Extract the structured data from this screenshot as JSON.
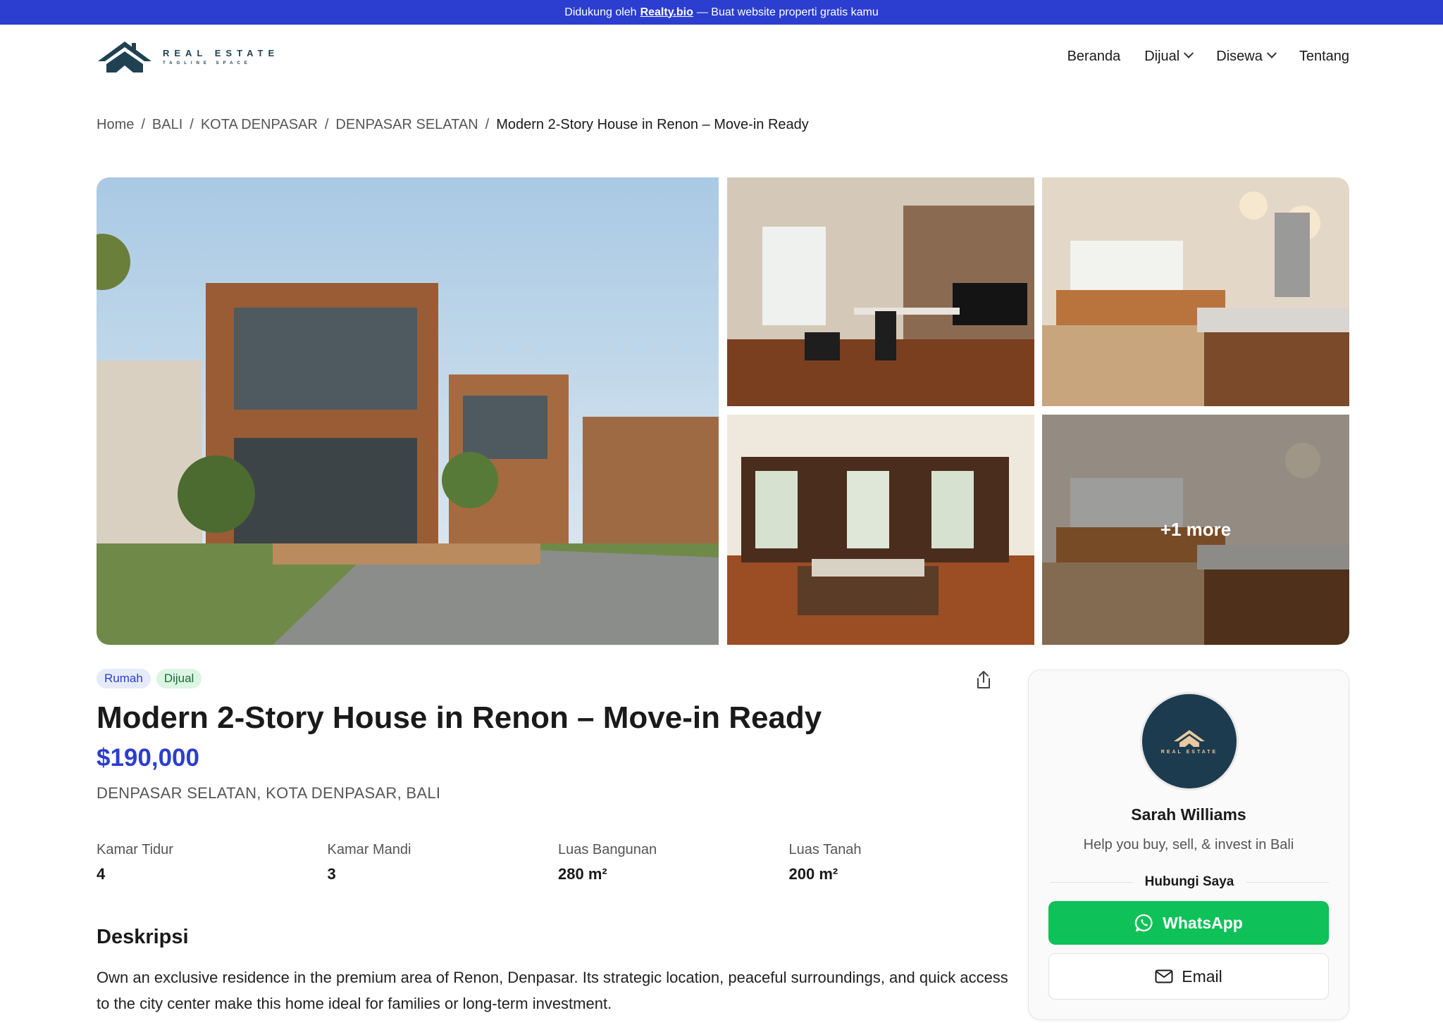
{
  "topbar": {
    "prefix": "Didukung oleh",
    "link": "Realty.bio",
    "suffix": "— Buat website properti gratis kamu"
  },
  "logo": {
    "main": "REAL ESTATE",
    "sub": "TAGLINE SPACE"
  },
  "nav": {
    "home": "Beranda",
    "sale": "Dijual",
    "rent": "Disewa",
    "about": "Tentang"
  },
  "breadcrumb": {
    "home": "Home",
    "province": "BALI",
    "city": "KOTA DENPASAR",
    "district": "DENPASAR SELATAN",
    "current": "Modern 2-Story House in Renon – Move-in Ready",
    "separator": "/"
  },
  "gallery": {
    "more_label": "+1 more"
  },
  "listing": {
    "type_badge": "Rumah",
    "status_badge": "Dijual",
    "title": "Modern 2-Story House in Renon – Move-in Ready",
    "price": "$190,000",
    "location": "DENPASAR SELATAN, KOTA DENPASAR, BALI",
    "specs": [
      {
        "label": "Kamar Tidur",
        "value": "4"
      },
      {
        "label": "Kamar Mandi",
        "value": "3"
      },
      {
        "label": "Luas Bangunan",
        "value": "280 m²"
      },
      {
        "label": "Luas Tanah",
        "value": "200 m²"
      }
    ],
    "description_title": "Deskripsi",
    "description": "Own an exclusive residence in the premium area of Renon, Denpasar. Its strategic location, peaceful surroundings, and quick access to the city center make this home ideal for families or long-term investment."
  },
  "agent": {
    "avatar_text": "REAL ESTATE",
    "name": "Sarah Williams",
    "tagline": "Help you buy, sell, & invest in Bali",
    "contact_label": "Hubungi Saya",
    "whatsapp_label": "WhatsApp",
    "email_label": "Email"
  },
  "colors": {
    "accent": "#2c3ecf",
    "whatsapp": "#0ec158",
    "logo": "#1f4253"
  }
}
